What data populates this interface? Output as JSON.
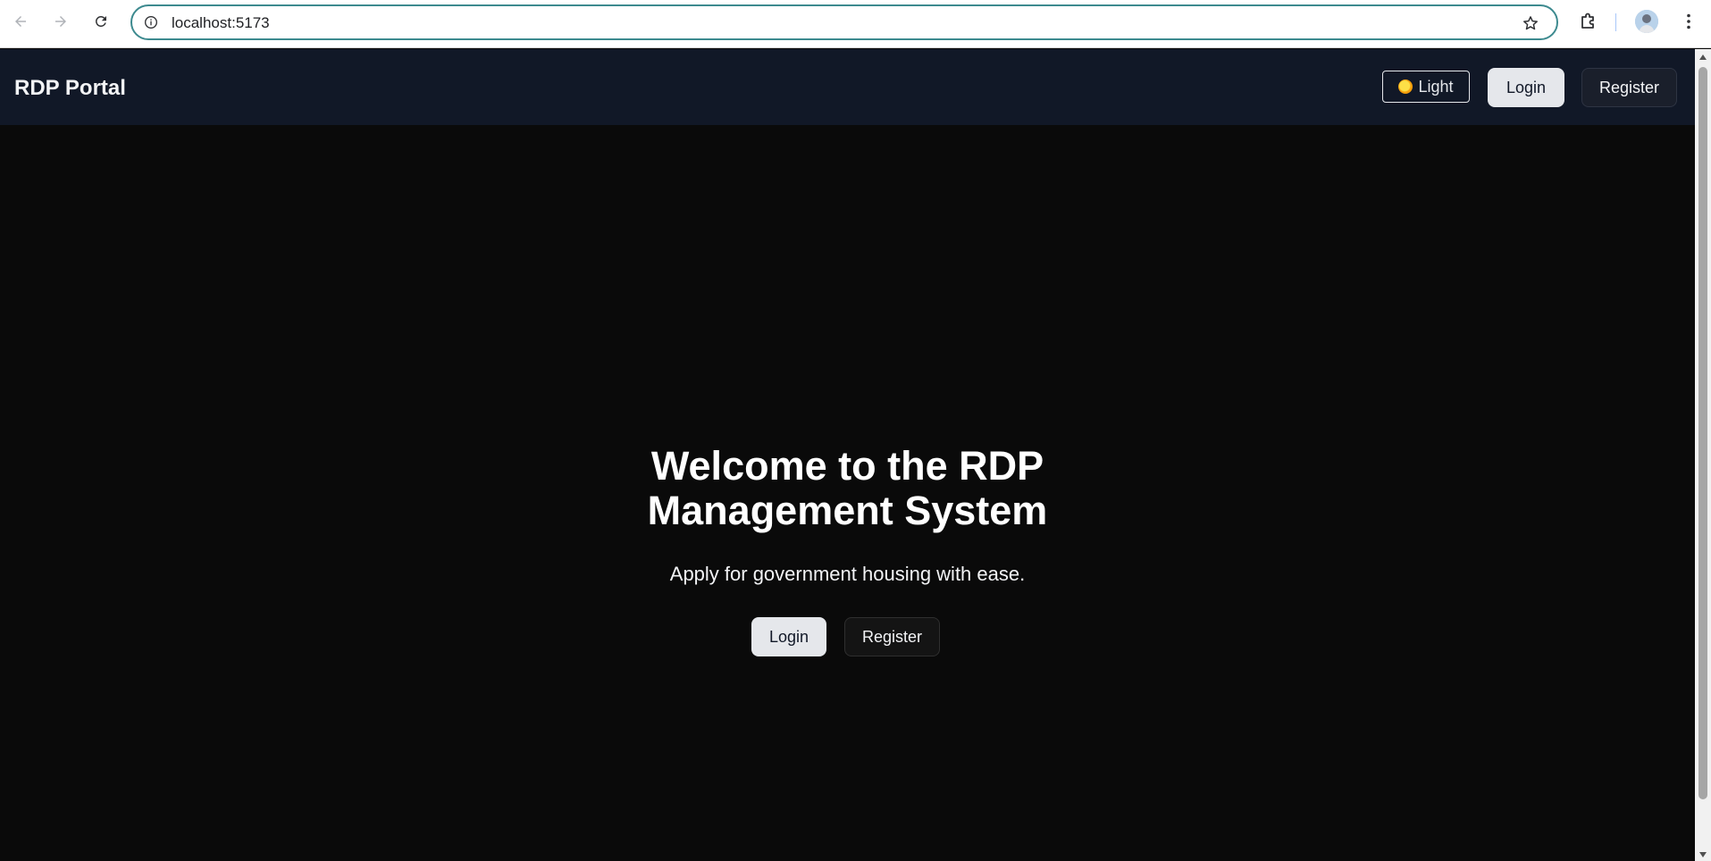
{
  "browser": {
    "url": "localhost:5173",
    "icons": {
      "back": "arrow-left-icon",
      "forward": "arrow-right-icon",
      "reload": "reload-icon",
      "info": "info-icon",
      "bookmark": "star-icon",
      "extensions": "puzzle-icon",
      "profile": "avatar",
      "menu": "kebab-menu-icon"
    },
    "accent_color": "#3d8a8f"
  },
  "header": {
    "brand": "RDP Portal",
    "theme_toggle_label": "Light",
    "login_label": "Login",
    "register_label": "Register",
    "background_color": "#111827"
  },
  "hero": {
    "title_line1": "Welcome to the RDP",
    "title_line2": "Management System",
    "subtitle": "Apply for government housing with ease.",
    "login_label": "Login",
    "register_label": "Register",
    "background_color": "#0a0a0a"
  }
}
